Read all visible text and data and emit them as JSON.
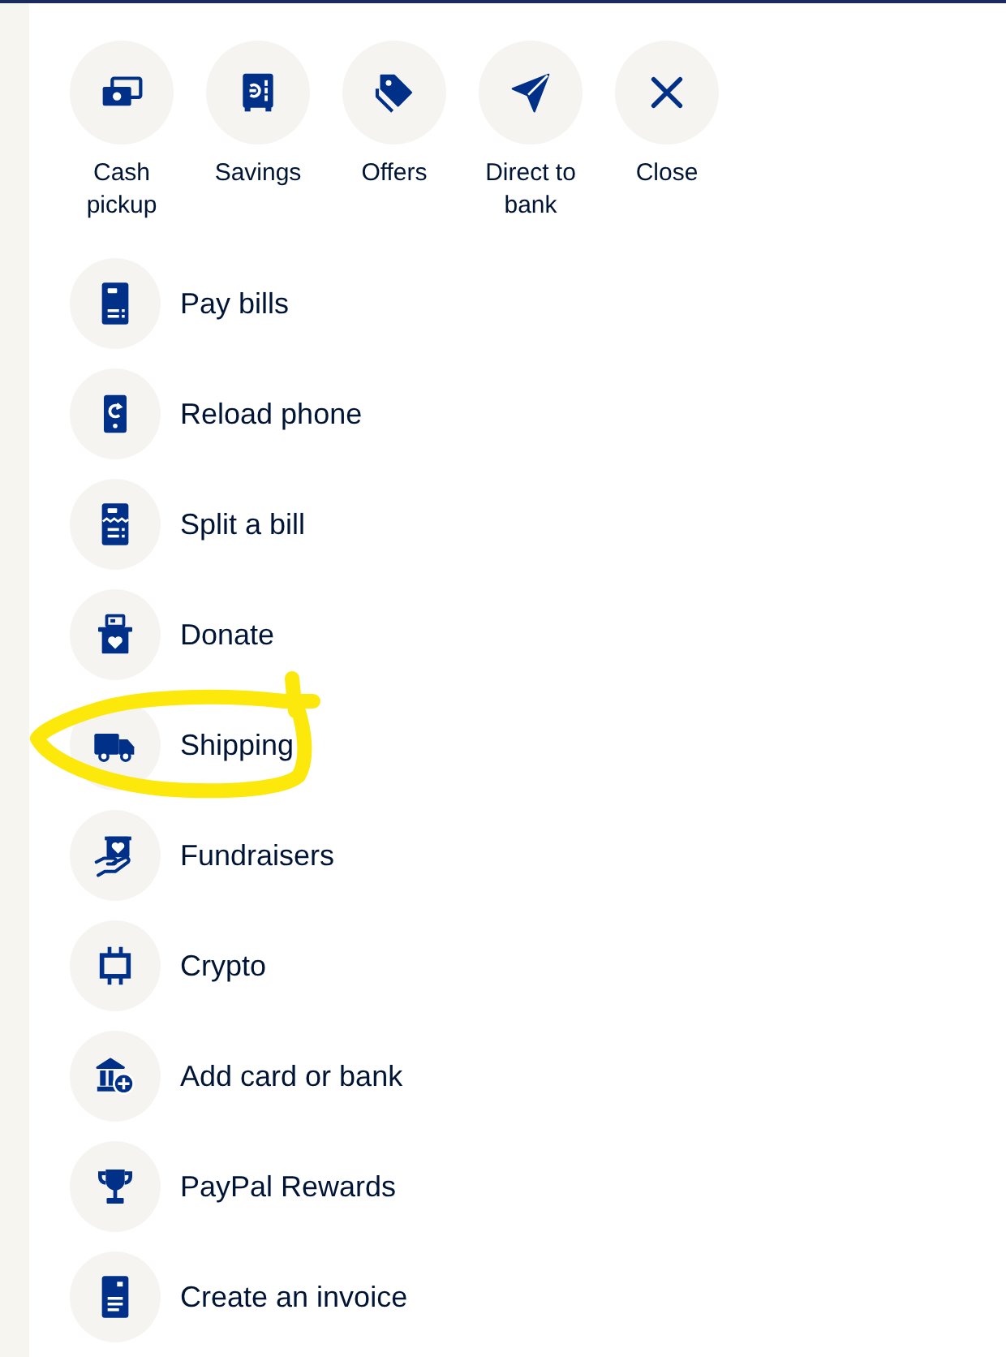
{
  "quick_actions": [
    {
      "label": "Cash pickup"
    },
    {
      "label": "Savings"
    },
    {
      "label": "Offers"
    },
    {
      "label": "Direct to bank"
    },
    {
      "label": "Close"
    }
  ],
  "actions": [
    {
      "label": "Pay bills",
      "highlighted": false
    },
    {
      "label": "Reload phone",
      "highlighted": false
    },
    {
      "label": "Split a bill",
      "highlighted": false
    },
    {
      "label": "Donate",
      "highlighted": false
    },
    {
      "label": "Shipping",
      "highlighted": true
    },
    {
      "label": "Fundraisers",
      "highlighted": false
    },
    {
      "label": "Crypto",
      "highlighted": false
    },
    {
      "label": "Add card or bank",
      "highlighted": false
    },
    {
      "label": "PayPal Rewards",
      "highlighted": false
    },
    {
      "label": "Create an invoice",
      "highlighted": false
    }
  ]
}
